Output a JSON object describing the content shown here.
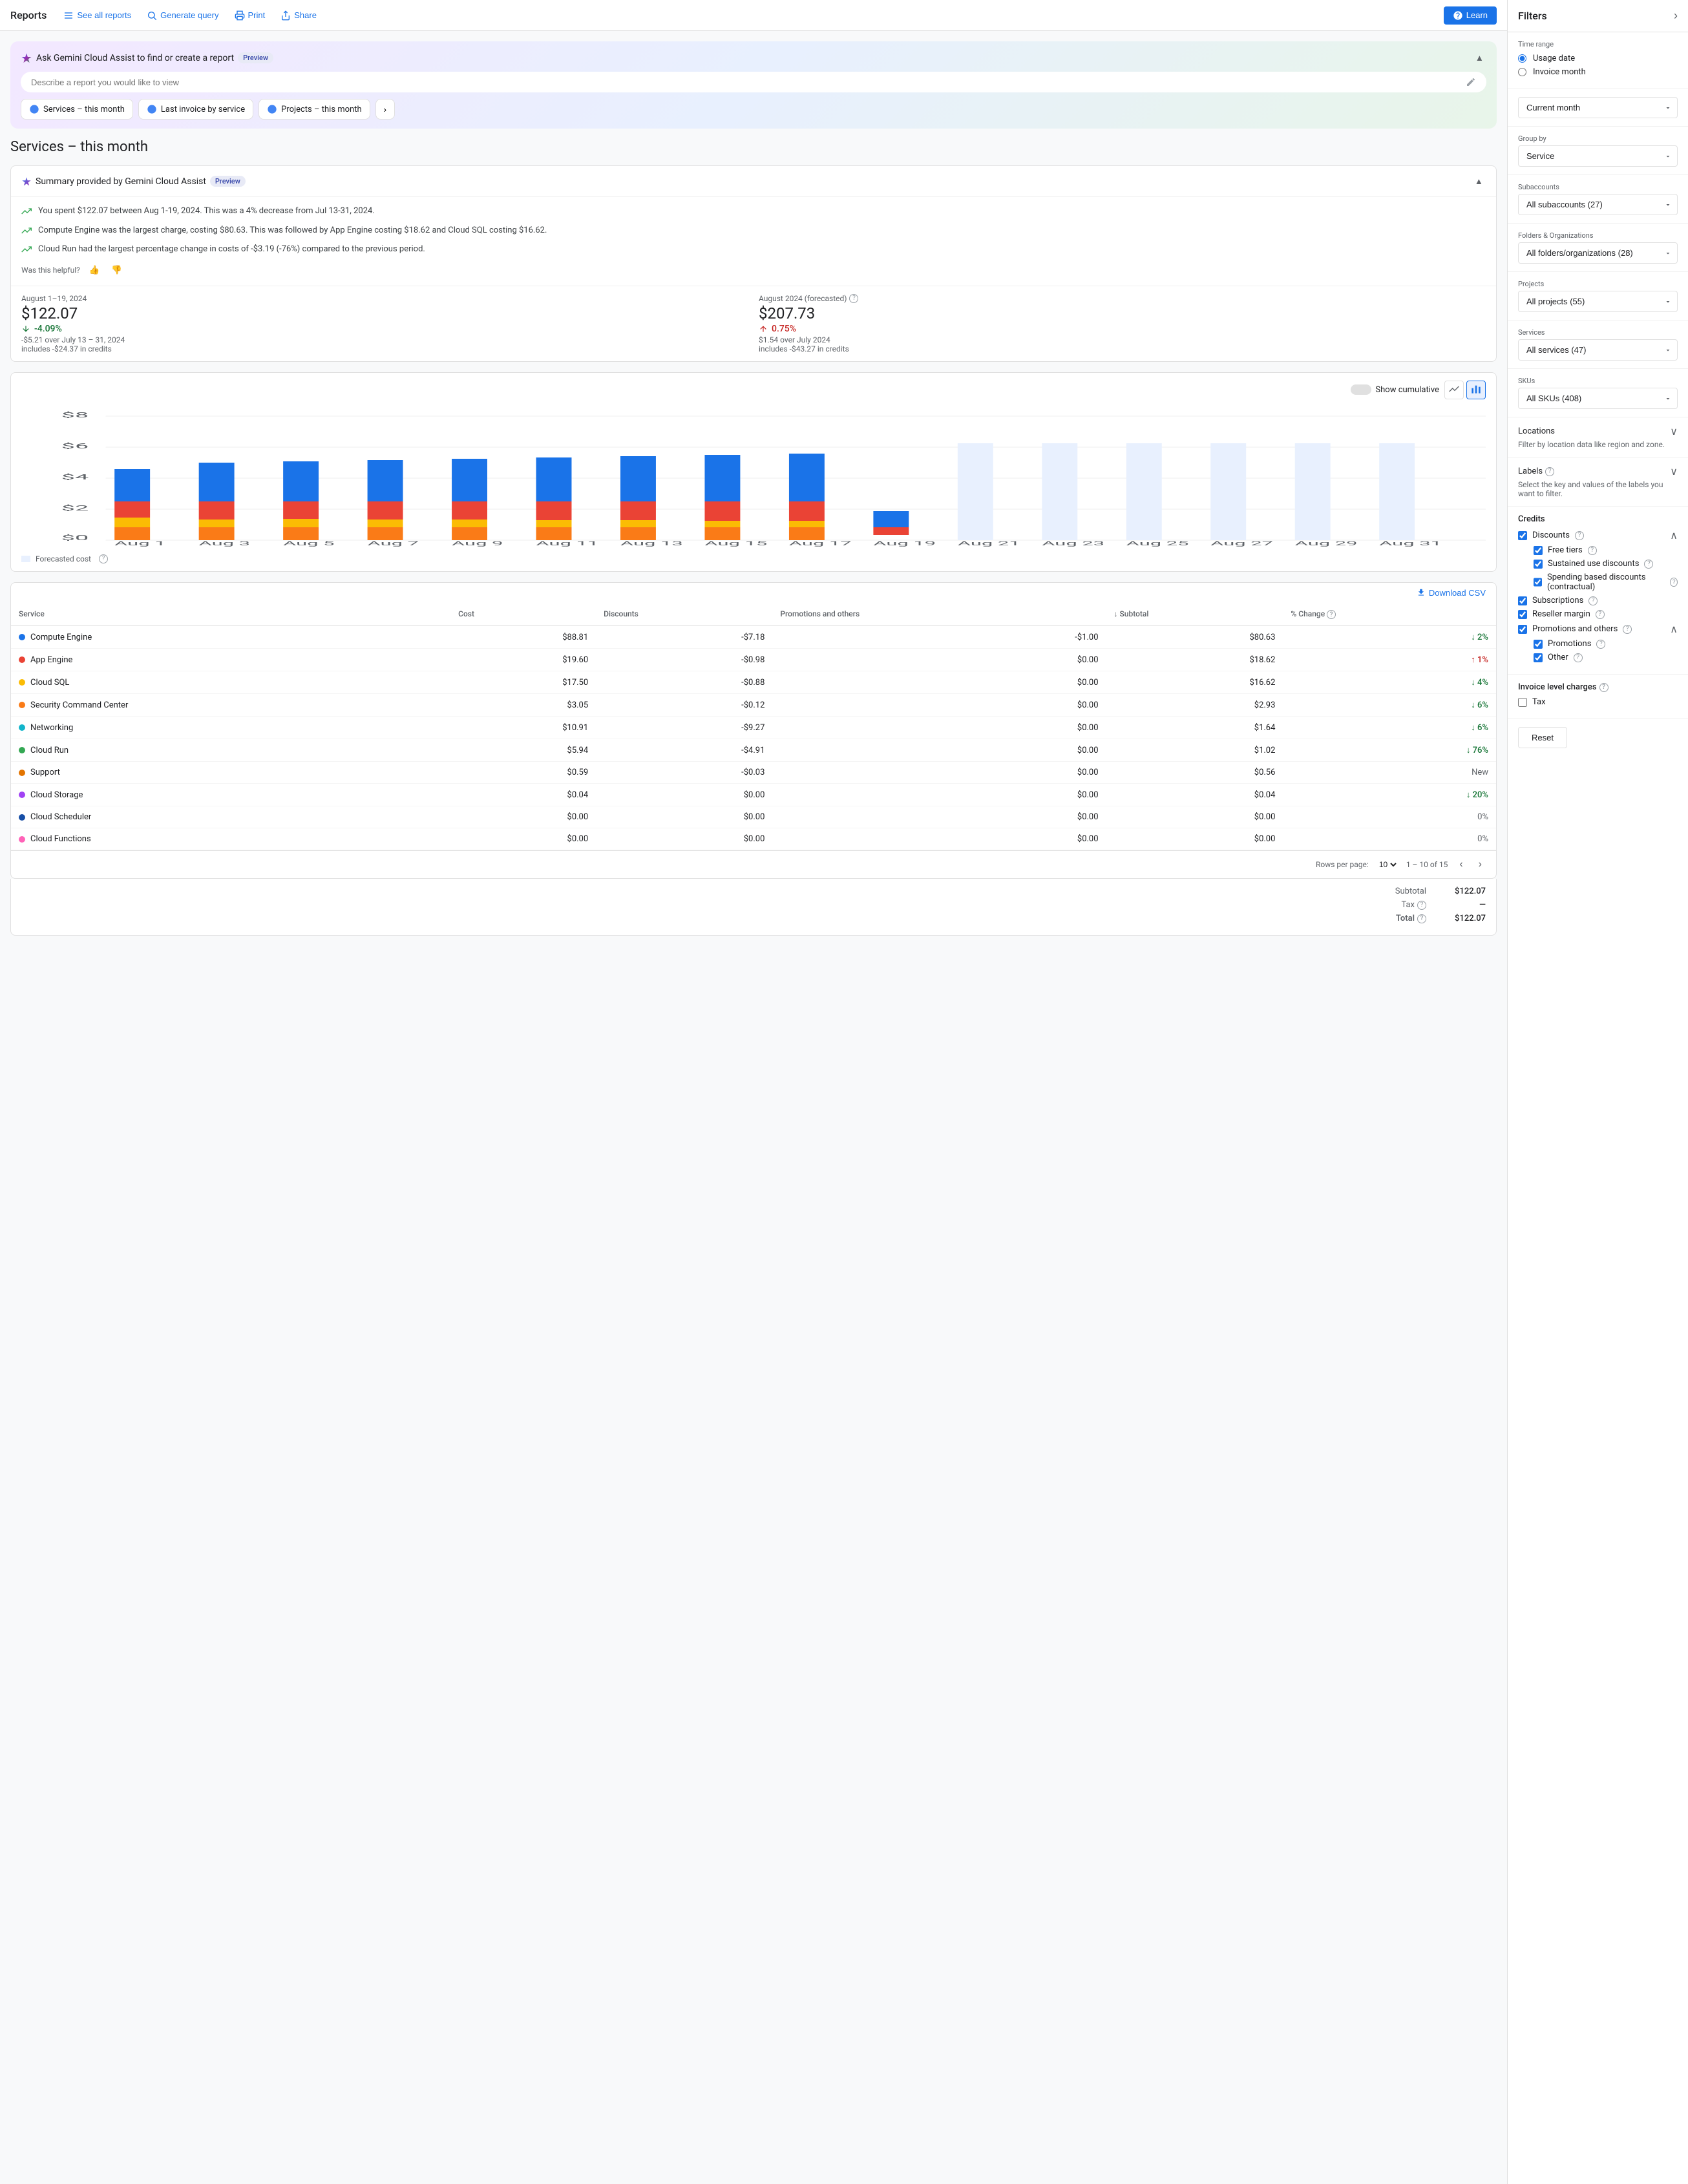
{
  "nav": {
    "title": "Reports",
    "buttons": [
      {
        "label": "See all reports",
        "icon": "list"
      },
      {
        "label": "Generate query",
        "icon": "search"
      },
      {
        "label": "Print",
        "icon": "print"
      },
      {
        "label": "Share",
        "icon": "share"
      }
    ],
    "learn_label": "Learn"
  },
  "gemini": {
    "title": "Ask Gemini Cloud Assist to find or create a report",
    "preview_badge": "Preview",
    "input_placeholder": "Describe a report you would like to view",
    "quick_reports": [
      {
        "label": "Services – this month"
      },
      {
        "label": "Last invoice by service"
      },
      {
        "label": "Projects – this month"
      }
    ]
  },
  "page_title": "Services – this month",
  "summary": {
    "title": "Summary provided by Gemini Cloud Assist",
    "preview_badge": "Preview",
    "items": [
      "You spent $122.07 between Aug 1-19, 2024. This was a 4% decrease from Jul 13-31, 2024.",
      "Compute Engine was the largest charge, costing $80.63. This was followed by App Engine costing $18.62 and Cloud SQL costing $16.62.",
      "Cloud Run had the largest percentage change in costs of -$3.19 (-76%) compared to the previous period."
    ],
    "feedback_prompt": "Was this helpful?"
  },
  "stats": {
    "current": {
      "period": "August 1–19, 2024",
      "value": "$122.07",
      "sub": "includes -$24.37 in credits",
      "change": "-4.09%",
      "change_type": "green",
      "change_sub": "-$5.21 over July 13 – 31, 2024"
    },
    "forecasted": {
      "period": "August 2024 (forecasted)",
      "value": "$207.73",
      "sub": "includes -$43.27 in credits",
      "change": "0.75%",
      "change_type": "red",
      "change_sub": "$1.54 over July 2024"
    }
  },
  "chart": {
    "show_cumulative_label": "Show cumulative",
    "y_axis_max": "$8",
    "forecasted_cost_label": "Forecasted cost",
    "x_labels": [
      "Aug 1",
      "Aug 3",
      "Aug 5",
      "Aug 7",
      "Aug 9",
      "Aug 11",
      "Aug 13",
      "Aug 15",
      "Aug 17",
      "Aug 19",
      "Aug 21",
      "Aug 23",
      "Aug 25",
      "Aug 27",
      "Aug 29",
      "Aug 31"
    ]
  },
  "table": {
    "download_label": "Download CSV",
    "columns": [
      "Service",
      "Cost",
      "Discounts",
      "Promotions and others",
      "Subtotal",
      "% Change"
    ],
    "rows": [
      {
        "service": "Compute Engine",
        "color": "dot-blue",
        "cost": "$88.81",
        "discounts": "-$7.18",
        "promotions": "-$1.00",
        "subtotal": "$80.63",
        "change": "2%",
        "change_type": "green"
      },
      {
        "service": "App Engine",
        "color": "dot-red",
        "cost": "$19.60",
        "discounts": "-$0.98",
        "promotions": "$0.00",
        "subtotal": "$18.62",
        "change": "1%",
        "change_type": "red"
      },
      {
        "service": "Cloud SQL",
        "color": "dot-yellow",
        "cost": "$17.50",
        "discounts": "-$0.88",
        "promotions": "$0.00",
        "subtotal": "$16.62",
        "change": "4%",
        "change_type": "green"
      },
      {
        "service": "Security Command Center",
        "color": "dot-orange",
        "cost": "$3.05",
        "discounts": "-$0.12",
        "promotions": "$0.00",
        "subtotal": "$2.93",
        "change": "6%",
        "change_type": "green"
      },
      {
        "service": "Networking",
        "color": "dot-teal",
        "cost": "$10.91",
        "discounts": "-$9.27",
        "promotions": "$0.00",
        "subtotal": "$1.64",
        "change": "6%",
        "change_type": "green"
      },
      {
        "service": "Cloud Run",
        "color": "dot-green",
        "cost": "$5.94",
        "discounts": "-$4.91",
        "promotions": "$0.00",
        "subtotal": "$1.02",
        "change": "76%",
        "change_type": "green"
      },
      {
        "service": "Support",
        "color": "dot-gold",
        "cost": "$0.59",
        "discounts": "-$0.03",
        "promotions": "$0.00",
        "subtotal": "$0.56",
        "change": "New",
        "change_type": "neutral"
      },
      {
        "service": "Cloud Storage",
        "color": "dot-purple",
        "cost": "$0.04",
        "discounts": "$0.00",
        "promotions": "$0.00",
        "subtotal": "$0.04",
        "change": "20%",
        "change_type": "green"
      },
      {
        "service": "Cloud Scheduler",
        "color": "dot-darkblue",
        "cost": "$0.00",
        "discounts": "$0.00",
        "promotions": "$0.00",
        "subtotal": "$0.00",
        "change": "0%",
        "change_type": "neutral"
      },
      {
        "service": "Cloud Functions",
        "color": "dot-pink",
        "cost": "$0.00",
        "discounts": "$0.00",
        "promotions": "$0.00",
        "subtotal": "$0.00",
        "change": "0%",
        "change_type": "neutral"
      }
    ],
    "pagination": {
      "rows_per_page_label": "Rows per page:",
      "rows_per_page_value": "10",
      "range": "1 – 10 of 15"
    },
    "totals": {
      "subtotal_label": "Subtotal",
      "subtotal_value": "$122.07",
      "tax_label": "Tax",
      "tax_value": "—",
      "total_label": "Total",
      "total_value": "$122.07"
    }
  },
  "filters": {
    "title": "Filters",
    "time_range": {
      "label": "Time range",
      "options": [
        "Usage date",
        "Invoice month"
      ],
      "selected": "Usage date"
    },
    "current_month": "Current month",
    "group_by": {
      "label": "Group by",
      "value": "Service"
    },
    "subaccounts": {
      "label": "Subaccounts",
      "value": "All subaccounts (27)"
    },
    "folders": {
      "label": "Folders & Organizations",
      "value": "All folders/organizations (28)"
    },
    "projects": {
      "label": "Projects",
      "value": "All projects (55)"
    },
    "services": {
      "label": "Services",
      "value": "All services (47)"
    },
    "skus": {
      "label": "SKUs",
      "value": "All SKUs (408)"
    },
    "locations": {
      "label": "Locations",
      "note": "Filter by location data like region and zone."
    },
    "labels": {
      "label": "Labels",
      "note": "Select the key and values of the labels you want to filter."
    },
    "credits": {
      "label": "Credits",
      "discounts": {
        "label": "Discounts",
        "checked": true,
        "items": [
          {
            "label": "Free tiers",
            "checked": true
          },
          {
            "label": "Sustained use discounts",
            "checked": true
          },
          {
            "label": "Spending based discounts (contractual)",
            "checked": true
          }
        ]
      },
      "subscriptions": {
        "label": "Subscriptions",
        "checked": true
      },
      "reseller_margin": {
        "label": "Reseller margin",
        "checked": true
      },
      "promotions": {
        "label": "Promotions and others",
        "checked": true,
        "items": [
          {
            "label": "Promotions",
            "checked": true
          },
          {
            "label": "Other",
            "checked": true
          }
        ]
      }
    },
    "invoice_charges": {
      "label": "Invoice level charges",
      "tax": {
        "label": "Tax",
        "checked": false
      }
    },
    "reset_label": "Reset"
  }
}
